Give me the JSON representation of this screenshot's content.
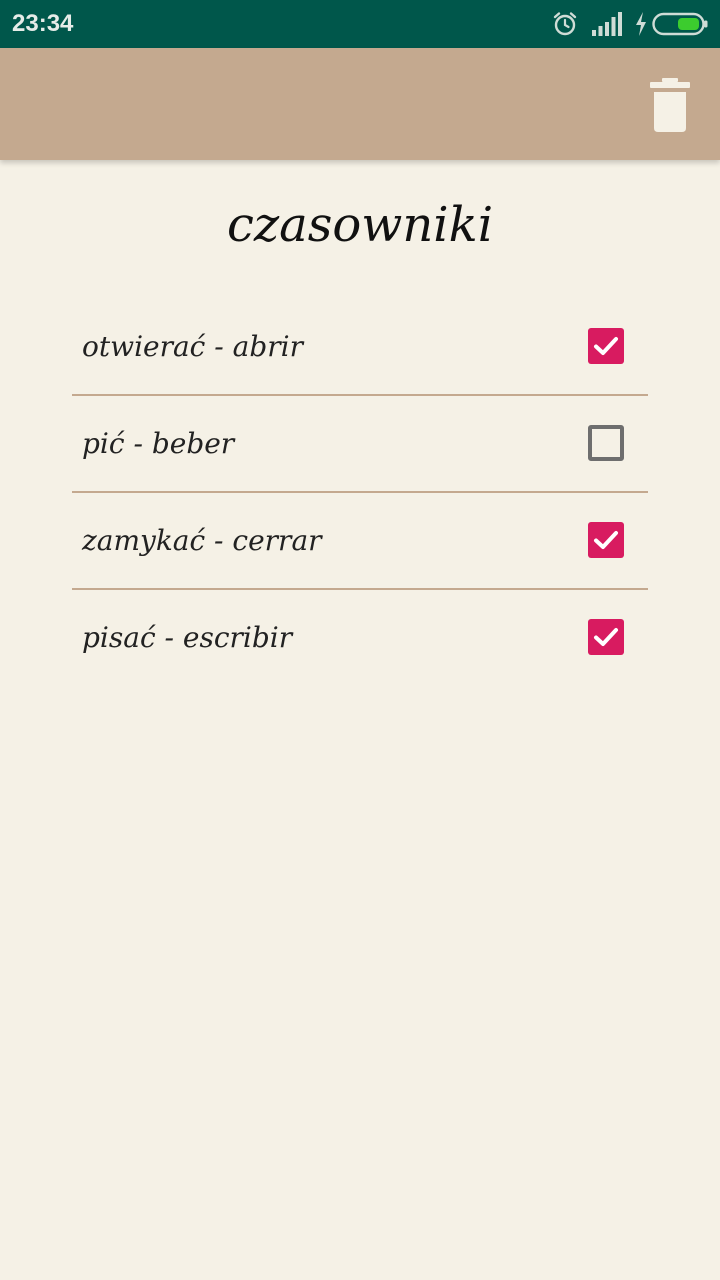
{
  "status_bar": {
    "time": "23:34",
    "icons": [
      "alarm-icon",
      "signal-icon",
      "charging-icon",
      "battery-icon"
    ]
  },
  "app_bar": {
    "actions": [
      "delete-icon"
    ]
  },
  "list": {
    "title": "czasowniki",
    "items": [
      {
        "label": "otwierać - abrir",
        "checked": true
      },
      {
        "label": "pić - beber",
        "checked": false
      },
      {
        "label": "zamykać - cerrar",
        "checked": true
      },
      {
        "label": "pisać - escribir",
        "checked": true
      }
    ]
  },
  "colors": {
    "status_bar": "#00574b",
    "app_bar": "#c4a98f",
    "background": "#f5f1e6",
    "checkbox_checked": "#d81b60",
    "checkbox_unchecked_border": "#6e6e6e",
    "divider": "#c4a98f",
    "battery_fill": "#3ccc2e"
  }
}
